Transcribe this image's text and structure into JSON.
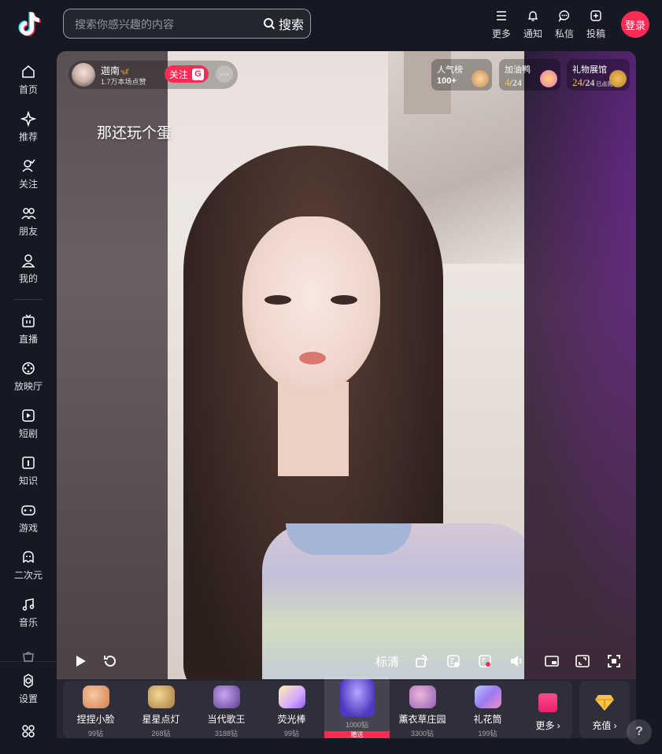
{
  "sidebar": {
    "items": [
      {
        "label": "首页",
        "icon": "home-icon"
      },
      {
        "label": "推荐",
        "icon": "sparkle-icon"
      },
      {
        "label": "关注",
        "icon": "follow-icon"
      },
      {
        "label": "朋友",
        "icon": "friends-icon"
      },
      {
        "label": "我的",
        "icon": "user-icon"
      },
      {
        "label": "直播",
        "icon": "tv-icon"
      },
      {
        "label": "放映厅",
        "icon": "film-icon"
      },
      {
        "label": "短剧",
        "icon": "play-icon"
      },
      {
        "label": "知识",
        "icon": "knowledge-icon"
      },
      {
        "label": "游戏",
        "icon": "game-icon"
      },
      {
        "label": "二次元",
        "icon": "anime-icon"
      },
      {
        "label": "音乐",
        "icon": "music-icon"
      },
      {
        "label": "",
        "icon": "shopping-icon"
      },
      {
        "label": "设置",
        "icon": "settings-icon"
      },
      {
        "label": "",
        "icon": "grid-icon"
      }
    ]
  },
  "search": {
    "placeholder": "搜索你感兴趣的内容",
    "button_label": "搜索"
  },
  "header": {
    "more_label": "更多",
    "notify_label": "通知",
    "message_label": "私信",
    "upload_label": "投稿",
    "login_label": "登录"
  },
  "live": {
    "host_name": "迦南",
    "host_sub": "1.7万本场点赞",
    "follow_label": "关注",
    "follow_badge": "G",
    "more_dots": "···",
    "caption": "那还玩个蛋",
    "popularity": {
      "title": "人气榜",
      "value": "100+"
    },
    "cheer": {
      "title": "加油鸭",
      "current": "4",
      "total": "/24"
    },
    "gift_hall": {
      "title": "礼物展馆",
      "current": "24",
      "total": "/24",
      "tag": "已点亮"
    }
  },
  "controls": {
    "quality_label": "标清"
  },
  "gifts": [
    {
      "name": "捏捏小脸",
      "price": "99钻",
      "color": "#e9a06f"
    },
    {
      "name": "星星点灯",
      "price": "268钻",
      "color": "#caa26a"
    },
    {
      "name": "当代歌王",
      "price": "3188钻",
      "color": "#8a6fb8"
    },
    {
      "name": "荧光棒",
      "price": "99钻",
      "color": "#c9a8f0"
    },
    {
      "name": "",
      "price": "1000钻",
      "color": "#6a5cd8",
      "selected": true,
      "send_label": "赠送"
    },
    {
      "name": "薰衣草庄园",
      "price": "3300钻",
      "color": "#b98bd9"
    },
    {
      "name": "礼花筒",
      "price": "199钻",
      "color": "#9b8ee8"
    }
  ],
  "more_gifts_label": "更多",
  "recharge_label": "充值",
  "help_label": "?",
  "colors": {
    "accent": "#fe2c55",
    "background": "#161823",
    "panel": "#2e2f3b"
  }
}
